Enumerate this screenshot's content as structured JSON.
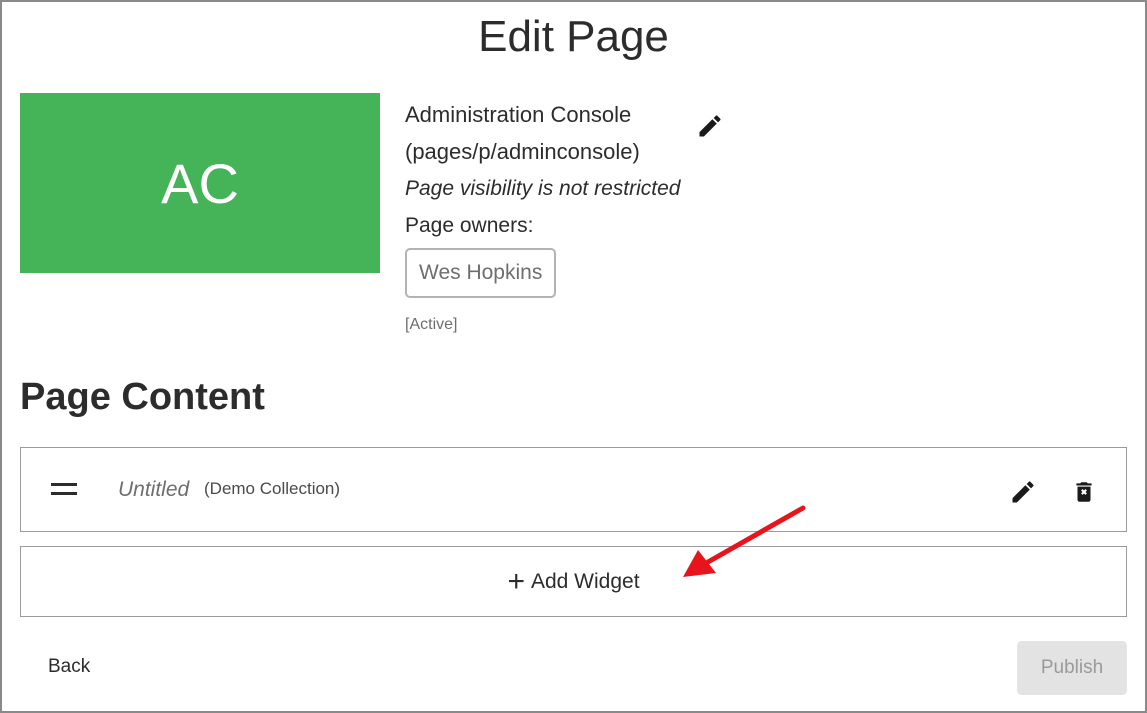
{
  "header": {
    "title": "Edit Page"
  },
  "page": {
    "initials": "AC",
    "tile_color": "#45b357",
    "name": "Administration Console",
    "path": "(pages/p/adminconsole)",
    "visibility": "Page visibility is not restricted",
    "owners_label": "Page owners:",
    "owners": [
      {
        "name": "Wes Hopkins",
        "status": "[Active]"
      }
    ],
    "edit_icon": "pencil-icon"
  },
  "content": {
    "title": "Page Content",
    "widgets": [
      {
        "title": "Untitled",
        "collection": "(Demo Collection)",
        "drag_icon": "drag-handle-icon",
        "edit_icon": "pencil-icon",
        "delete_icon": "trash-icon"
      }
    ],
    "add_widget_label": "Add Widget",
    "add_icon": "plus-icon"
  },
  "footer": {
    "back_label": "Back",
    "publish_label": "Publish",
    "publish_disabled": true
  },
  "annotation": {
    "color": "#e8141b"
  }
}
